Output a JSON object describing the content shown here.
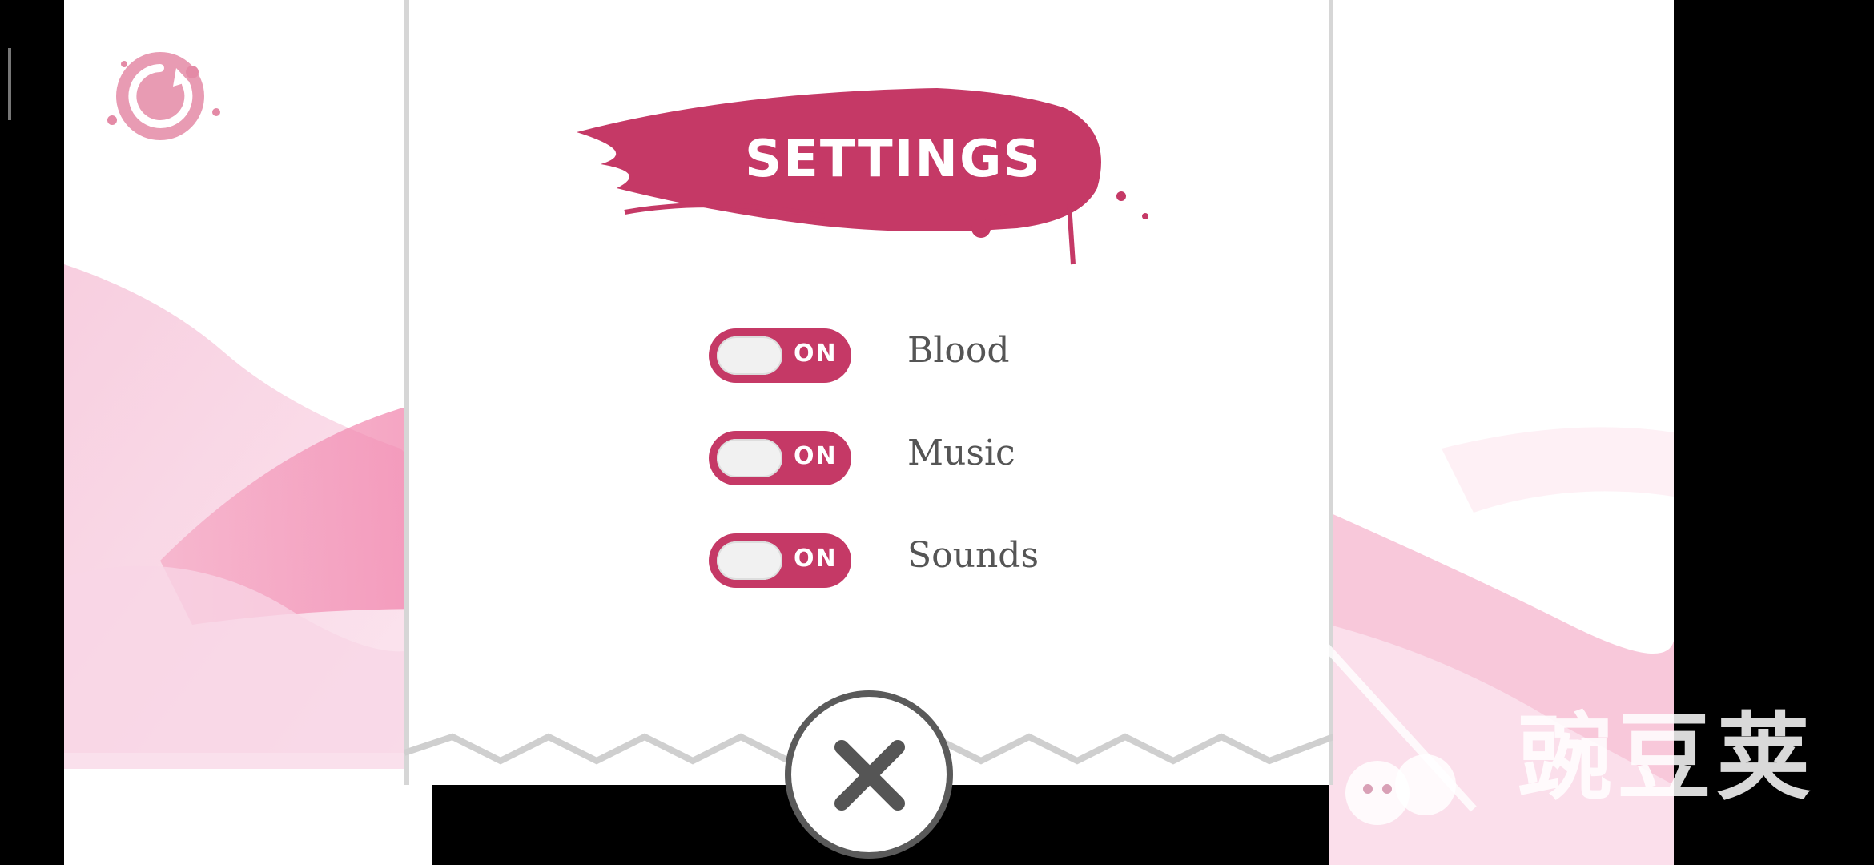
{
  "screen": {
    "title": "SETTINGS",
    "accent_color": "#c53966",
    "close_icon": "close-x-icon",
    "back_icon": "refresh-splat-icon"
  },
  "toggles": [
    {
      "id": "blood",
      "label": "Blood",
      "state_text": "ON",
      "on": true
    },
    {
      "id": "music",
      "label": "Music",
      "state_text": "ON",
      "on": true
    },
    {
      "id": "sounds",
      "label": "Sounds",
      "state_text": "ON",
      "on": true
    }
  ],
  "watermark": {
    "text": "豌豆荚",
    "icon": "wandoujia-logo-icon"
  }
}
